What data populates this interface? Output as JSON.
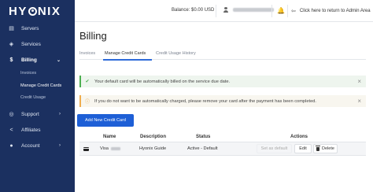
{
  "app": {
    "logo_text": "HYONIX"
  },
  "sidebar": {
    "items": [
      {
        "label": "Servers",
        "icon": "server-icon"
      },
      {
        "label": "Services",
        "icon": "cube-icon"
      },
      {
        "label": "Billing",
        "icon": "dollar-icon",
        "active": true
      },
      {
        "label": "Support",
        "icon": "lifebuoy-icon"
      },
      {
        "label": "Affiliates",
        "icon": "share-icon"
      },
      {
        "label": "Account",
        "icon": "user-circle-icon"
      }
    ],
    "billing_sub": [
      {
        "label": "Invoices"
      },
      {
        "label": "Manage Credit Cards",
        "current": true
      },
      {
        "label": "Credit Usage"
      }
    ]
  },
  "topbar": {
    "balance": "Balance: $0.00 USD",
    "return_link": "Click here to return to Admin Area"
  },
  "page": {
    "title": "Billing",
    "tabs": [
      {
        "label": "Invoices"
      },
      {
        "label": "Manage Credit Cards",
        "active": true
      },
      {
        "label": "Credit Usage History"
      }
    ]
  },
  "alerts": {
    "info": "Your default card will be automatically billed on the service due date.",
    "warning": "If you do not want to be automatically charged, please remove your card after the payment has been completed."
  },
  "actions": {
    "add_card": "Add New Credit Card"
  },
  "table": {
    "headers": {
      "name": "Name",
      "description": "Description",
      "status": "Status",
      "actions": "Actions"
    },
    "rows": [
      {
        "name": "Visa",
        "description": "Hyonix Guide",
        "status": "Active - Default",
        "set_default": "Set as default",
        "edit": "Edit",
        "delete": "Delete"
      }
    ]
  },
  "colors": {
    "sidebar_bg": "#1b3060",
    "accent": "#1e5fd6",
    "success": "#4caf50",
    "warning": "#f0ad4e"
  }
}
